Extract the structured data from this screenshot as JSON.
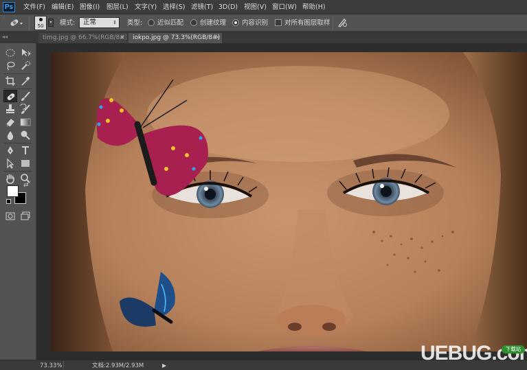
{
  "app": {
    "logo": "Ps"
  },
  "menu": [
    "文件(F)",
    "编辑(E)",
    "图像(I)",
    "图层(L)",
    "文字(Y)",
    "选择(S)",
    "滤镜(T)",
    "3D(D)",
    "视图(V)",
    "窗口(W)",
    "帮助(H)"
  ],
  "options": {
    "brush_size": "50",
    "mode_label": "模式:",
    "mode_value": "正常",
    "type_label": "类型:",
    "radio_proximity": "近似匹配",
    "radio_texture": "创建纹理",
    "radio_content_aware": "内容识别",
    "sample_all_layers": "对所有图层取样",
    "selected_type": "内容识别"
  },
  "tabs": [
    {
      "label": "timg.jpg @ 66.7%(RGB/8#)",
      "active": false
    },
    {
      "label": "iokpo.jpg @ 73.3%(RGB/8#) *",
      "active": true
    }
  ],
  "tools": [
    "rectangular-marquee",
    "move",
    "lasso",
    "quick-selection",
    "crop",
    "eyedropper",
    "spot-healing-brush",
    "brush",
    "clone-stamp",
    "history-brush",
    "eraser",
    "gradient",
    "blur",
    "dodge",
    "pen",
    "type",
    "path-selection",
    "rectangle",
    "hand",
    "zoom",
    "foreground-background-colors",
    "quick-mask",
    "screen-mode"
  ],
  "status": {
    "zoom": "73.33%",
    "doc_info": "文档:2.93M/2.93M"
  },
  "watermark": {
    "brand": "UEBUG.com",
    "badge": "下载站"
  },
  "colors": {
    "foreground": "#ffffff",
    "background": "#000000",
    "accent": "#2f8ad8"
  }
}
